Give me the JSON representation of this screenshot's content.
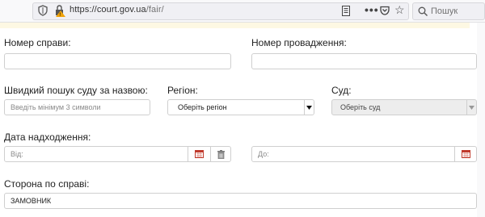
{
  "browser": {
    "url_domain": "https://court.gov.ua",
    "url_path": "/fair/",
    "search_placeholder": "Пошук",
    "icons": [
      "shield-icon",
      "lock-icon",
      "reader-view-icon",
      "more-icon",
      "pocket-icon",
      "bookmark-star-icon",
      "search-icon"
    ]
  },
  "form": {
    "case_number": {
      "label": "Номер справи:",
      "value": ""
    },
    "proceeding_number": {
      "label": "Номер провадження:",
      "value": ""
    },
    "court_search": {
      "label": "Швидкий пошук суду за назвою:",
      "placeholder": "Введіть мінімум 3 символи"
    },
    "region": {
      "label": "Регіон:",
      "selected": "Оберіть регіон"
    },
    "court": {
      "label": "Суд:",
      "selected": "Оберіть суд",
      "disabled": true
    },
    "receipt_date": {
      "label": "Дата надходження:",
      "from_placeholder": "Від:",
      "to_placeholder": "До:"
    },
    "party": {
      "label": "Сторона по справі:",
      "value": "ЗАМОВНИК"
    }
  },
  "colors": {
    "calendar_icon": "#c0392b",
    "notice_bar": "#fdf8e3"
  }
}
